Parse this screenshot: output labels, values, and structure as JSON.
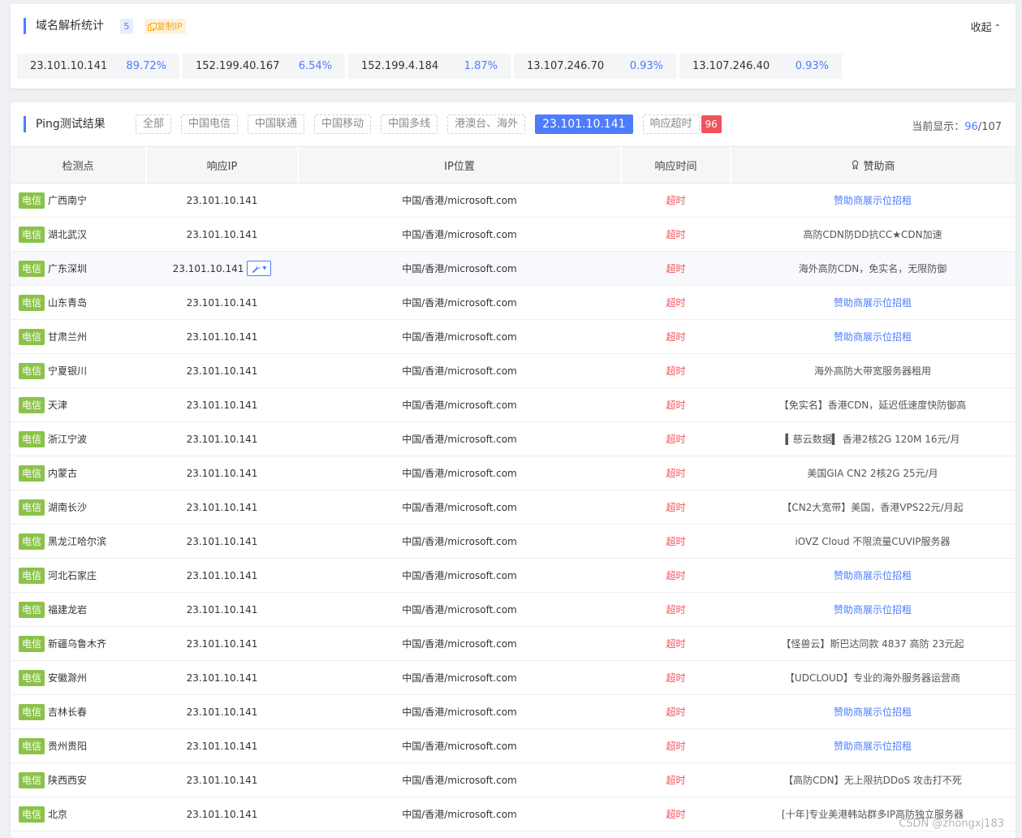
{
  "dns_stats": {
    "title": "域名解析统计",
    "count": "5",
    "copy_label": "复制IP",
    "collapse_label": "收起",
    "ips": [
      {
        "ip": "23.101.10.141",
        "percent": "89.72%"
      },
      {
        "ip": "152.199.40.167",
        "percent": "6.54%"
      },
      {
        "ip": "152.199.4.184",
        "percent": "1.87%"
      },
      {
        "ip": "13.107.246.70",
        "percent": "0.93%"
      },
      {
        "ip": "13.107.246.40",
        "percent": "0.93%"
      }
    ]
  },
  "ping": {
    "title": "Ping测试结果",
    "filters": [
      "全部",
      "中国电信",
      "中国联通",
      "中国移动",
      "中国多线",
      "港澳台、海外"
    ],
    "active_filter": "23.101.10.141",
    "timeout_filter": "响应超时",
    "timeout_count": "96",
    "current_display_label": "当前显示：",
    "current_shown": "96",
    "total": "/107",
    "columns": [
      "检测点",
      "响应IP",
      "IP位置",
      "响应时间",
      "赞助商"
    ],
    "rows": [
      {
        "isp": "电信",
        "node": "广西南宁",
        "ip": "23.101.10.141",
        "location": "中国/香港/microsoft.com",
        "time": "超时",
        "sponsor": "赞助商展示位招租",
        "sponsor_link": true
      },
      {
        "isp": "电信",
        "node": "湖北武汉",
        "ip": "23.101.10.141",
        "location": "中国/香港/microsoft.com",
        "time": "超时",
        "sponsor": "高防CDN防DD抗CC★CDN加速",
        "sponsor_link": false
      },
      {
        "isp": "电信",
        "node": "广东深圳",
        "ip": "23.101.10.141",
        "location": "中国/香港/microsoft.com",
        "time": "超时",
        "sponsor": "海外高防CDN，免实名，无限防御",
        "sponsor_link": false,
        "tool": true
      },
      {
        "isp": "电信",
        "node": "山东青岛",
        "ip": "23.101.10.141",
        "location": "中国/香港/microsoft.com",
        "time": "超时",
        "sponsor": "赞助商展示位招租",
        "sponsor_link": true
      },
      {
        "isp": "电信",
        "node": "甘肃兰州",
        "ip": "23.101.10.141",
        "location": "中国/香港/microsoft.com",
        "time": "超时",
        "sponsor": "赞助商展示位招租",
        "sponsor_link": true
      },
      {
        "isp": "电信",
        "node": "宁夏银川",
        "ip": "23.101.10.141",
        "location": "中国/香港/microsoft.com",
        "time": "超时",
        "sponsor": "海外高防大带宽服务器租用",
        "sponsor_link": false
      },
      {
        "isp": "电信",
        "node": "天津",
        "ip": "23.101.10.141",
        "location": "中国/香港/microsoft.com",
        "time": "超时",
        "sponsor": "【免实名】香港CDN，延迟低速度快防御高",
        "sponsor_link": false
      },
      {
        "isp": "电信",
        "node": "浙江宁波",
        "ip": "23.101.10.141",
        "location": "中国/香港/microsoft.com",
        "time": "超时",
        "sponsor": "▍慈云数据▍ 香港2核2G 120M 16元/月",
        "sponsor_link": false
      },
      {
        "isp": "电信",
        "node": "内蒙古",
        "ip": "23.101.10.141",
        "location": "中国/香港/microsoft.com",
        "time": "超时",
        "sponsor": "美国GIA CN2 2核2G 25元/月",
        "sponsor_link": false
      },
      {
        "isp": "电信",
        "node": "湖南长沙",
        "ip": "23.101.10.141",
        "location": "中国/香港/microsoft.com",
        "time": "超时",
        "sponsor": "【CN2大宽带】美国，香港VPS22元/月起",
        "sponsor_link": false
      },
      {
        "isp": "电信",
        "node": "黑龙江哈尔滨",
        "ip": "23.101.10.141",
        "location": "中国/香港/microsoft.com",
        "time": "超时",
        "sponsor": "iOVZ Cloud 不限流量CUVIP服务器",
        "sponsor_link": false
      },
      {
        "isp": "电信",
        "node": "河北石家庄",
        "ip": "23.101.10.141",
        "location": "中国/香港/microsoft.com",
        "time": "超时",
        "sponsor": "赞助商展示位招租",
        "sponsor_link": true
      },
      {
        "isp": "电信",
        "node": "福建龙岩",
        "ip": "23.101.10.141",
        "location": "中国/香港/microsoft.com",
        "time": "超时",
        "sponsor": "赞助商展示位招租",
        "sponsor_link": true
      },
      {
        "isp": "电信",
        "node": "新疆乌鲁木齐",
        "ip": "23.101.10.141",
        "location": "中国/香港/microsoft.com",
        "time": "超时",
        "sponsor": "【怪兽云】斯巴达同款 4837 高防 23元起",
        "sponsor_link": false
      },
      {
        "isp": "电信",
        "node": "安徽滁州",
        "ip": "23.101.10.141",
        "location": "中国/香港/microsoft.com",
        "time": "超时",
        "sponsor": "【UDCLOUD】专业的海外服务器运营商",
        "sponsor_link": false
      },
      {
        "isp": "电信",
        "node": "吉林长春",
        "ip": "23.101.10.141",
        "location": "中国/香港/microsoft.com",
        "time": "超时",
        "sponsor": "赞助商展示位招租",
        "sponsor_link": true
      },
      {
        "isp": "电信",
        "node": "贵州贵阳",
        "ip": "23.101.10.141",
        "location": "中国/香港/microsoft.com",
        "time": "超时",
        "sponsor": "赞助商展示位招租",
        "sponsor_link": true
      },
      {
        "isp": "电信",
        "node": "陕西西安",
        "ip": "23.101.10.141",
        "location": "中国/香港/microsoft.com",
        "time": "超时",
        "sponsor": "【高防CDN】无上限抗DDoS 攻击打不死",
        "sponsor_link": false
      },
      {
        "isp": "电信",
        "node": "北京",
        "ip": "23.101.10.141",
        "location": "中国/香港/microsoft.com",
        "time": "超时",
        "sponsor": "[十年]专业美港韩站群多IP高防独立服务器",
        "sponsor_link": false
      }
    ]
  },
  "watermark": "CSDN @zhongxj183",
  "colors": {
    "accent": "#4d7cfe",
    "isp_tag": "#8bc34a",
    "timeout": "#f0525c",
    "copy": "#f5a623"
  },
  "icons": [
    "copy-icon",
    "chevron-up-icon",
    "sponsor-icon",
    "wrench-icon",
    "caret-down-icon"
  ]
}
